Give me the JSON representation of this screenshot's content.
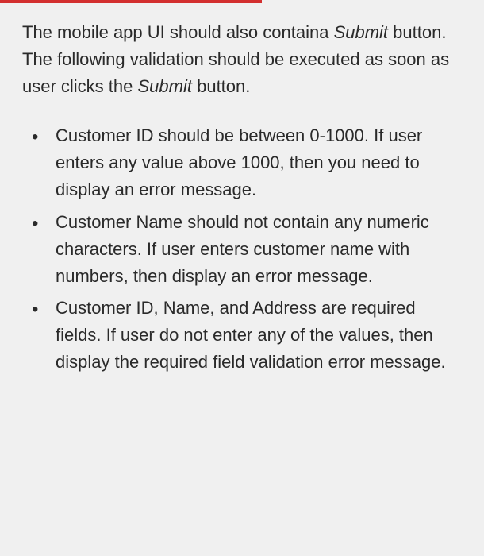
{
  "intro": {
    "part1": "The mobile app UI should also containa ",
    "submit1": "Submit",
    "part2": " button. The following validation should be executed as soon as user clicks the ",
    "submit2": "Submit",
    "part3": " button."
  },
  "bullets": [
    "Customer ID should be between 0-1000. If user enters any value above 1000, then you need to display an error message.",
    "Customer Name should not contain any numeric characters. If user enters customer name with numbers, then display an error message.",
    "Customer ID, Name, and Address are required fields. If user do not enter any of the values, then display the required field validation error message."
  ]
}
